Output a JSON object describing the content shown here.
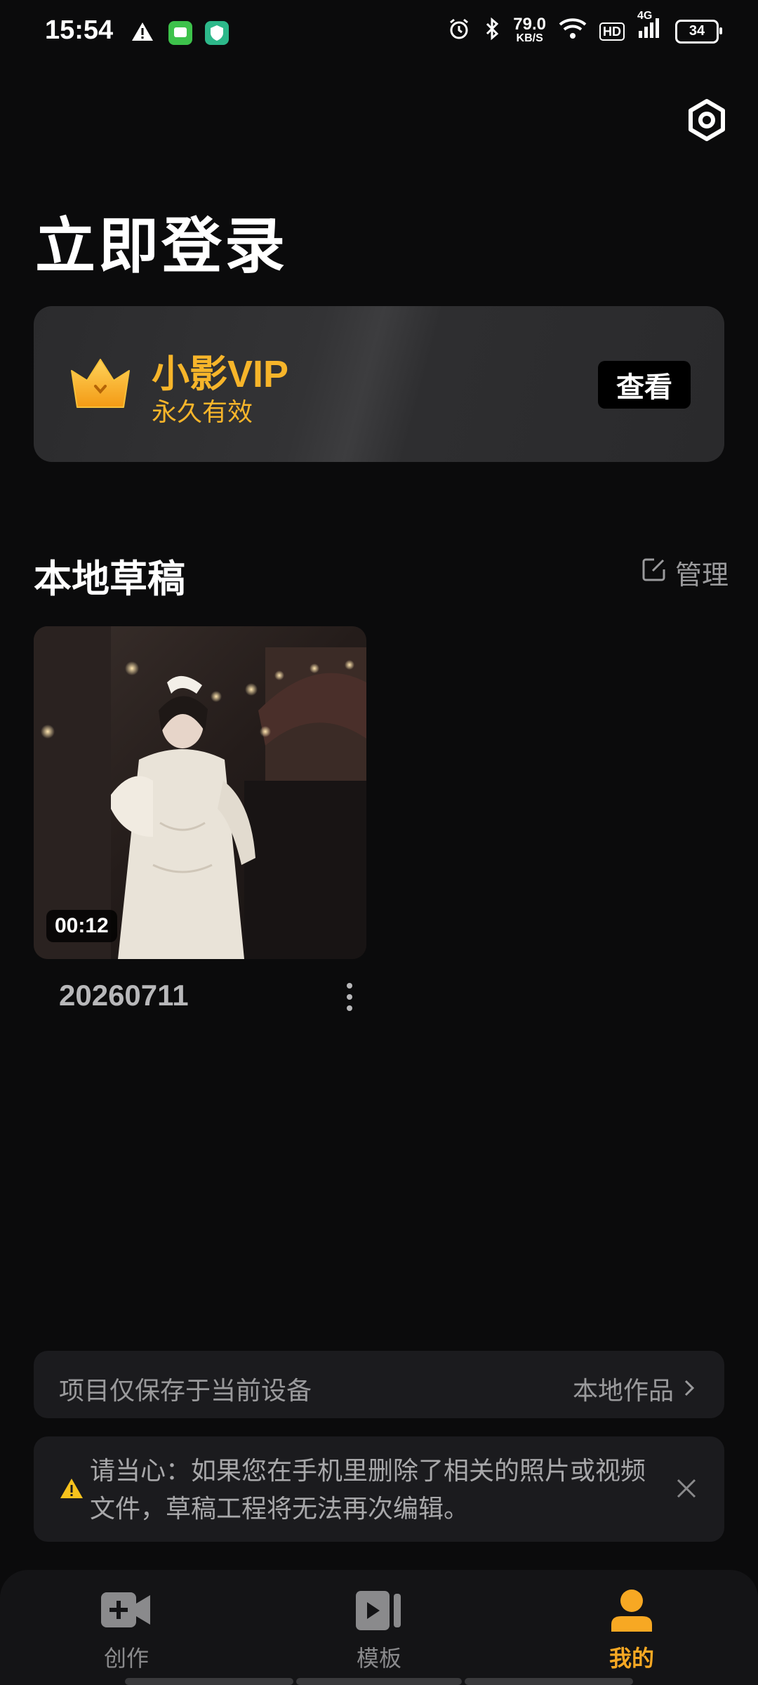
{
  "status_bar": {
    "time": "15:54",
    "net_speed_value": "79.0",
    "net_speed_unit": "KB/S",
    "hd_label": "HD",
    "network": "4G",
    "battery": "34"
  },
  "header": {
    "settings_icon": "hexagon-gear-icon",
    "title": "立即登录"
  },
  "vip": {
    "icon": "crown-icon",
    "name": "小影VIP",
    "validity": "永久有效",
    "view_button": "查看",
    "accent_color": "#f7b52a"
  },
  "drafts": {
    "title": "本地草稿",
    "manage_label": "管理",
    "items": [
      {
        "duration": "00:12",
        "name": "20260711"
      }
    ]
  },
  "notices": {
    "storage_text": "项目仅保存于当前设备",
    "local_works_link": "本地作品",
    "warning_text": "请当心：如果您在手机里删除了相关的照片或视频文件，草稿工程将无法再次编辑。"
  },
  "bottom_nav": {
    "items": [
      {
        "label": "创作",
        "icon": "video-camera-plus-icon",
        "active": false
      },
      {
        "label": "模板",
        "icon": "template-play-icon",
        "active": false
      },
      {
        "label": "我的",
        "icon": "person-icon",
        "active": true
      }
    ],
    "active_color": "#f7a823"
  }
}
